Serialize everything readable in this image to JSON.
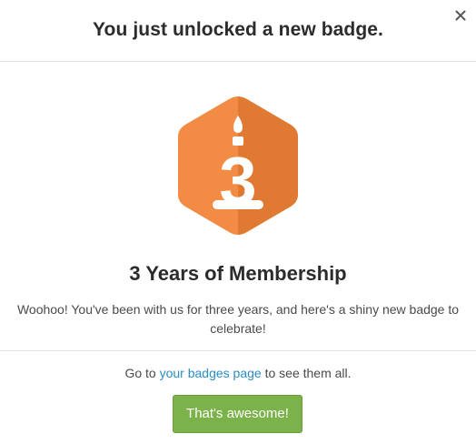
{
  "header": {
    "title": "You just unlocked a new badge."
  },
  "close_icon": "close-icon",
  "badge": {
    "icon": "birthday-candle-three-hexagon-icon",
    "numeral": "3",
    "colors": {
      "light": "#f28c45",
      "dark": "#e07a33",
      "figure": "#ffffff"
    },
    "title": "3 Years of Membership",
    "description": "Woohoo! You've been with us for three years, and here's a shiny new badge to celebrate!"
  },
  "footer": {
    "goto_prefix": "Go to ",
    "goto_link": "your badges page",
    "goto_suffix": " to see them all.",
    "button_label": "That's awesome!"
  },
  "colors": {
    "button": "#7bb24a",
    "link": "#2a8fc6"
  }
}
